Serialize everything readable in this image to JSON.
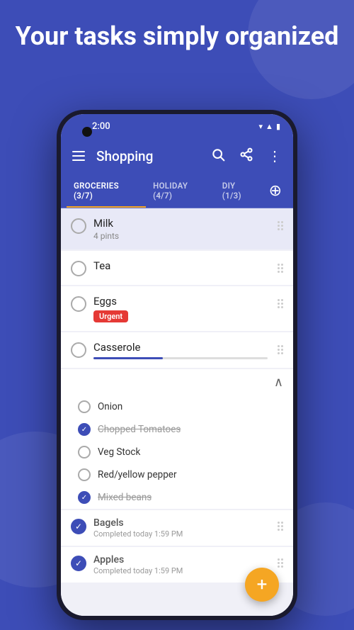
{
  "header": {
    "title": "Your tasks simply organized"
  },
  "status_bar": {
    "time": "2:00",
    "wifi_icon": "▼",
    "signal_icon": "▲",
    "battery_icon": "▮"
  },
  "app_bar": {
    "title": "Shopping",
    "search_label": "search",
    "share_label": "share",
    "more_label": "more"
  },
  "tabs": [
    {
      "label": "GROCERIES (3/7)",
      "active": true
    },
    {
      "label": "HOLIDAY (4/7)",
      "active": false
    },
    {
      "label": "DIY (1/3)",
      "active": false
    }
  ],
  "tasks": [
    {
      "id": "milk",
      "title": "Milk",
      "subtitle": "4 pints",
      "highlighted": true,
      "completed": false,
      "badge": null
    },
    {
      "id": "tea",
      "title": "Tea",
      "subtitle": null,
      "highlighted": false,
      "completed": false,
      "badge": null
    },
    {
      "id": "eggs",
      "title": "Eggs",
      "subtitle": null,
      "highlighted": false,
      "completed": false,
      "badge": "Urgent"
    },
    {
      "id": "casserole",
      "title": "Casserole",
      "subtitle": null,
      "highlighted": false,
      "completed": false,
      "badge": null
    }
  ],
  "sub_items": [
    {
      "id": "onion",
      "text": "Onion",
      "completed": false
    },
    {
      "id": "chopped-tomatoes",
      "text": "Chopped Tomatoes",
      "completed": true
    },
    {
      "id": "veg-stock",
      "text": "Veg Stock",
      "completed": false
    },
    {
      "id": "red-pepper",
      "text": "Red/yellow pepper",
      "completed": false
    },
    {
      "id": "mixed-beans",
      "text": "Mixed beans",
      "completed": true
    }
  ],
  "completed_tasks": [
    {
      "id": "bagels",
      "title": "Bagels",
      "subtitle": "Completed today 1:59 PM"
    },
    {
      "id": "apples",
      "title": "Apples",
      "subtitle": "Completed today 1:59 PM"
    }
  ],
  "fab": {
    "icon": "+"
  }
}
